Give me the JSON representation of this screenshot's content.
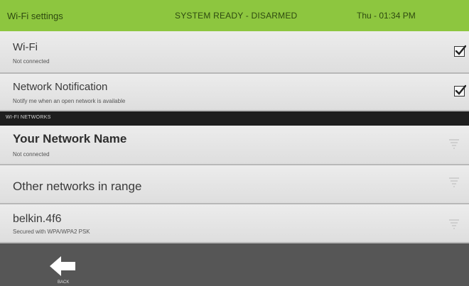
{
  "header": {
    "title": "Wi-Fi settings",
    "status": "SYSTEM READY - DISARMED",
    "clock": "Thu - 01:34 PM",
    "bg_color": "#8dc63f"
  },
  "wifi_toggle": {
    "label": "Wi-Fi",
    "sublabel": "Not connected",
    "checked": true
  },
  "network_notification": {
    "label": "Network Notification",
    "sublabel": "Notify me when an open network is available",
    "checked": true
  },
  "section_header": "WI-FI NETWORKS",
  "networks": [
    {
      "name": "Your Network Name",
      "status": "Not connected",
      "icon": "wifi-signal-icon"
    },
    {
      "name": "Other networks in range",
      "status": "",
      "icon": "wifi-signal-icon"
    },
    {
      "name": "belkin.4f6",
      "status": "Secured with WPA/WPA2 PSK",
      "icon": "wifi-signal-icon"
    }
  ],
  "footer": {
    "back_label": "BACK",
    "back_icon": "arrow-left-icon"
  }
}
